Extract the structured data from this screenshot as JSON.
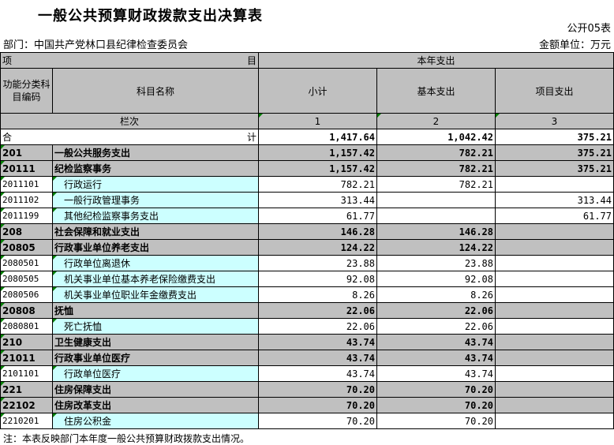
{
  "title": "一般公共预算财政拨款支出决算表",
  "table_no": "公开05表",
  "department": "部门：中国共产党林口县纪律检查委员会",
  "unit": "金额单位：万元",
  "header": {
    "item_left": "项",
    "item_right": "目",
    "current_year": "本年支出",
    "func_code": "功能分类科目编码",
    "subject_name": "科目名称",
    "subtotal": "小计",
    "basic": "基本支出",
    "project": "项目支出",
    "column_label": "栏次",
    "col1": "1",
    "col2": "2",
    "col3": "3"
  },
  "total": {
    "left": "合",
    "right": "计",
    "subtotal": "1,417.64",
    "basic": "1,042.42",
    "project": "375.21"
  },
  "rows": [
    {
      "code": "201",
      "name": "一般公共服务支出",
      "subtotal": "1,157.42",
      "basic": "782.21",
      "project": "375.21",
      "level": "gray"
    },
    {
      "code": "20111",
      "name": "纪检监察事务",
      "subtotal": "1,157.42",
      "basic": "782.21",
      "project": "375.21",
      "level": "gray"
    },
    {
      "code": "2011101",
      "name": "行政运行",
      "subtotal": "782.21",
      "basic": "782.21",
      "project": "",
      "level": "leaf"
    },
    {
      "code": "2011102",
      "name": "一般行政管理事务",
      "subtotal": "313.44",
      "basic": "",
      "project": "313.44",
      "level": "leaf"
    },
    {
      "code": "2011199",
      "name": "其他纪检监察事务支出",
      "subtotal": "61.77",
      "basic": "",
      "project": "61.77",
      "level": "leaf"
    },
    {
      "code": "208",
      "name": "社会保障和就业支出",
      "subtotal": "146.28",
      "basic": "146.28",
      "project": "",
      "level": "gray"
    },
    {
      "code": "20805",
      "name": "行政事业单位养老支出",
      "subtotal": "124.22",
      "basic": "124.22",
      "project": "",
      "level": "gray"
    },
    {
      "code": "2080501",
      "name": "行政单位离退休",
      "subtotal": "23.88",
      "basic": "23.88",
      "project": "",
      "level": "leaf"
    },
    {
      "code": "2080505",
      "name": "机关事业单位基本养老保险缴费支出",
      "subtotal": "92.08",
      "basic": "92.08",
      "project": "",
      "level": "leaf"
    },
    {
      "code": "2080506",
      "name": "机关事业单位职业年金缴费支出",
      "subtotal": "8.26",
      "basic": "8.26",
      "project": "",
      "level": "leaf"
    },
    {
      "code": "20808",
      "name": "抚恤",
      "subtotal": "22.06",
      "basic": "22.06",
      "project": "",
      "level": "gray"
    },
    {
      "code": "2080801",
      "name": "死亡抚恤",
      "subtotal": "22.06",
      "basic": "22.06",
      "project": "",
      "level": "leaf"
    },
    {
      "code": "210",
      "name": "卫生健康支出",
      "subtotal": "43.74",
      "basic": "43.74",
      "project": "",
      "level": "gray"
    },
    {
      "code": "21011",
      "name": "行政事业单位医疗",
      "subtotal": "43.74",
      "basic": "43.74",
      "project": "",
      "level": "gray"
    },
    {
      "code": "2101101",
      "name": "行政单位医疗",
      "subtotal": "43.74",
      "basic": "43.74",
      "project": "",
      "level": "leaf"
    },
    {
      "code": "221",
      "name": "住房保障支出",
      "subtotal": "70.20",
      "basic": "70.20",
      "project": "",
      "level": "gray"
    },
    {
      "code": "22102",
      "name": "住房改革支出",
      "subtotal": "70.20",
      "basic": "70.20",
      "project": "",
      "level": "gray"
    },
    {
      "code": "2210201",
      "name": "住房公积金",
      "subtotal": "70.20",
      "basic": "70.20",
      "project": "",
      "level": "leaf"
    }
  ],
  "note": "注：本表反映部门本年度一般公共预算财政拨款支出情况。",
  "colors": {
    "header_gray": "#c0c0c0",
    "leaf_cyan": "#ccffff",
    "marker_green": "#008000"
  }
}
